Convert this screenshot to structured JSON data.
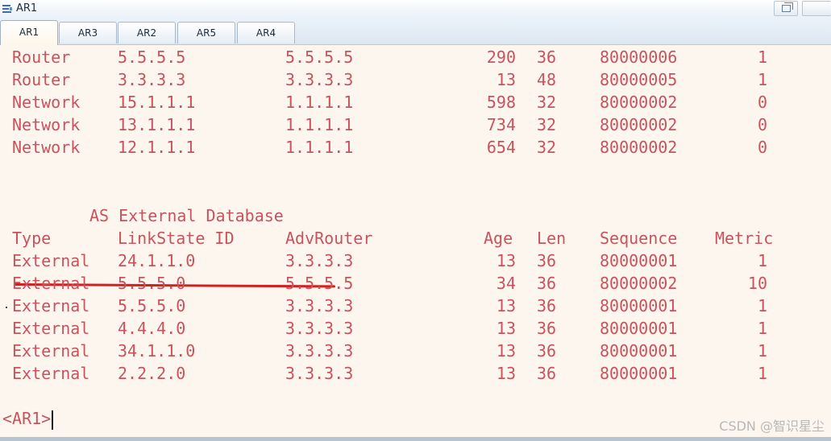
{
  "window": {
    "title": "AR1",
    "app_icon": "terminal-app-icon",
    "controls": [
      "restore-icon"
    ]
  },
  "tabs": [
    {
      "label": "AR1",
      "active": true
    },
    {
      "label": "AR3",
      "active": false
    },
    {
      "label": "AR2",
      "active": false
    },
    {
      "label": "AR5",
      "active": false
    },
    {
      "label": "AR4",
      "active": false
    }
  ],
  "area_rows": [
    [
      "Router",
      "5.5.5.5",
      "5.5.5.5",
      "290",
      "36",
      "80000006",
      "1"
    ],
    [
      "Router",
      "3.3.3.3",
      "3.3.3.3",
      "13",
      "48",
      "80000005",
      "1"
    ],
    [
      "Network",
      "15.1.1.1",
      "1.1.1.1",
      "598",
      "32",
      "80000002",
      "0"
    ],
    [
      "Network",
      "13.1.1.1",
      "1.1.1.1",
      "734",
      "32",
      "80000002",
      "0"
    ],
    [
      "Network",
      "12.1.1.1",
      "1.1.1.1",
      "654",
      "32",
      "80000002",
      "0"
    ]
  ],
  "external_db": {
    "title": "AS External Database",
    "headers": [
      "Type",
      "LinkState ID",
      "AdvRouter",
      "Age",
      "Len",
      "Sequence",
      "Metric"
    ],
    "rows": [
      [
        "External",
        "24.1.1.0",
        "3.3.3.3",
        "13",
        "36",
        "80000001",
        "1"
      ],
      [
        "External",
        "5.5.5.0",
        "5.5.5.5",
        "34",
        "36",
        "80000002",
        "10"
      ],
      [
        "External",
        "5.5.5.0",
        "3.3.3.3",
        "13",
        "36",
        "80000001",
        "1"
      ],
      [
        "External",
        "4.4.4.0",
        "3.3.3.3",
        "13",
        "36",
        "80000001",
        "1"
      ],
      [
        "External",
        "34.1.1.0",
        "3.3.3.3",
        "13",
        "36",
        "80000001",
        "1"
      ],
      [
        "External",
        "2.2.2.0",
        "3.3.3.3",
        "13",
        "36",
        "80000001",
        "1"
      ]
    ],
    "struck_row_index": 1
  },
  "prompt": "<AR1>",
  "watermark": "CSDN @智识星尘",
  "colors": {
    "terminal_text": "#c7535f",
    "terminal_background": "#fdf6ee",
    "strike_line": "#d21f1f"
  }
}
